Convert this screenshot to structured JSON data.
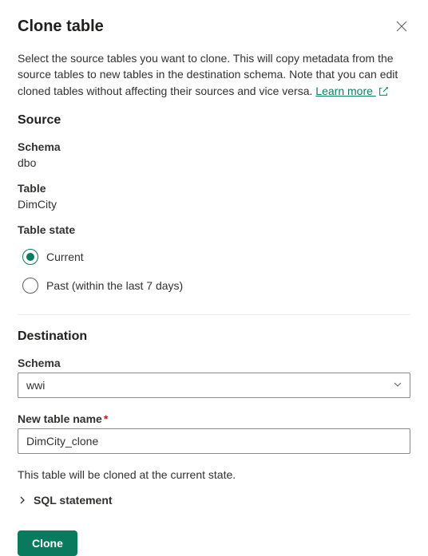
{
  "header": {
    "title": "Clone table"
  },
  "description": {
    "text": "Select the source tables you want to clone. This will copy metadata from the source tables to new tables in the destination schema. Note that you can edit cloned tables without affecting their sources and vice versa. ",
    "learn_more": "Learn more "
  },
  "source": {
    "heading": "Source",
    "schema_label": "Schema",
    "schema_value": "dbo",
    "table_label": "Table",
    "table_value": "DimCity",
    "state_label": "Table state",
    "state_options": {
      "current": "Current",
      "past": "Past (within the last 7 days)"
    }
  },
  "destination": {
    "heading": "Destination",
    "schema_label": "Schema",
    "schema_value": "wwi",
    "new_table_label": "New table name",
    "new_table_value": "DimCity_clone"
  },
  "note": "This table will be cloned at the current state.",
  "sql_expander": "SQL statement",
  "actions": {
    "clone": "Clone"
  }
}
